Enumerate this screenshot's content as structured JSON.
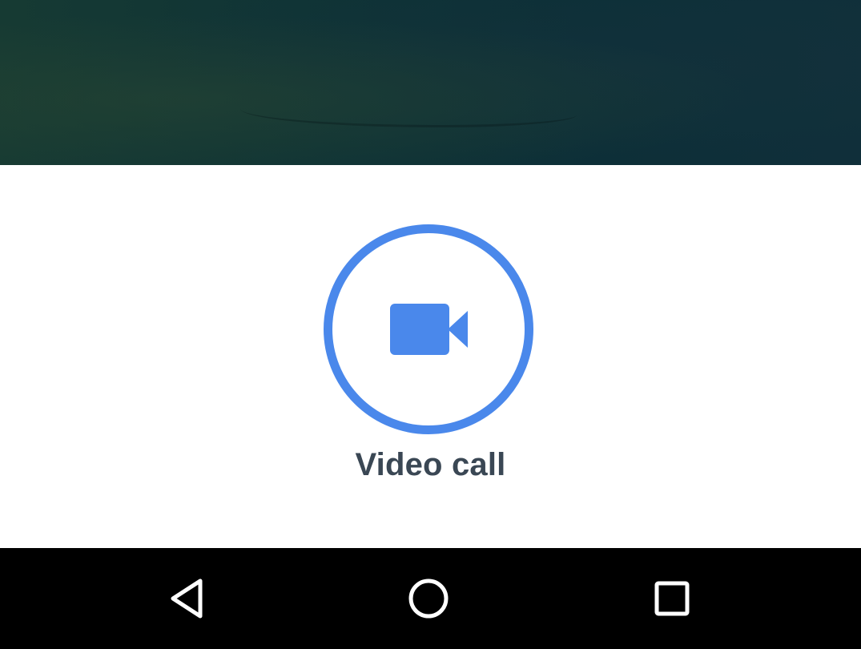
{
  "background": {
    "description_color": "#0f3336"
  },
  "call_option": {
    "label": "Video call",
    "icon": "video-camera-icon",
    "accent_color": "#4a88eb",
    "label_color": "#3a4754"
  },
  "navigation_bar": {
    "buttons": [
      {
        "icon": "back-triangle-icon"
      },
      {
        "icon": "home-circle-icon"
      },
      {
        "icon": "recent-apps-square-icon"
      }
    ]
  }
}
